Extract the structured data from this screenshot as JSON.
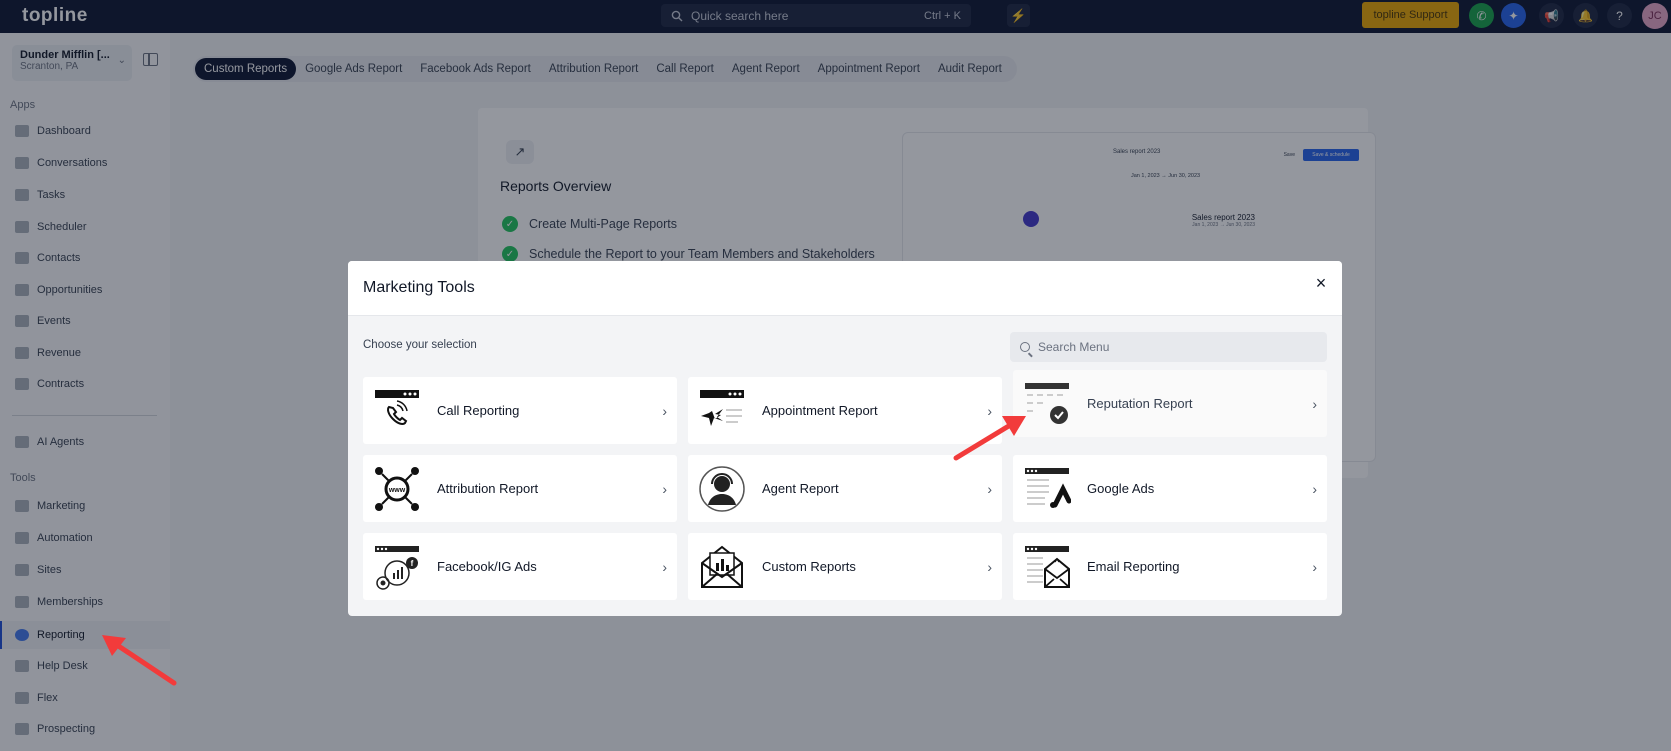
{
  "topbar": {
    "logo": "topline",
    "search_placeholder": "Quick search here",
    "search_shortcut": "Ctrl + K",
    "support_label": "topline Support",
    "avatar_initials": "JC"
  },
  "sidebar": {
    "account_name": "Dunder Mifflin [...",
    "account_location": "Scranton, PA",
    "apps_label": "Apps",
    "tools_label": "Tools",
    "apps": [
      {
        "label": "Dashboard"
      },
      {
        "label": "Conversations"
      },
      {
        "label": "Tasks"
      },
      {
        "label": "Scheduler"
      },
      {
        "label": "Contacts"
      },
      {
        "label": "Opportunities"
      },
      {
        "label": "Events"
      },
      {
        "label": "Revenue"
      },
      {
        "label": "Contracts"
      }
    ],
    "ai_agents": "AI Agents",
    "tools": [
      {
        "label": "Marketing"
      },
      {
        "label": "Automation"
      },
      {
        "label": "Sites"
      },
      {
        "label": "Memberships"
      },
      {
        "label": "Reporting"
      },
      {
        "label": "Help Desk"
      },
      {
        "label": "Flex"
      },
      {
        "label": "Prospecting"
      }
    ]
  },
  "tabs": [
    {
      "label": "Custom Reports",
      "active": true
    },
    {
      "label": "Google Ads Report"
    },
    {
      "label": "Facebook Ads Report"
    },
    {
      "label": "Attribution Report"
    },
    {
      "label": "Call Report"
    },
    {
      "label": "Agent Report"
    },
    {
      "label": "Appointment Report"
    },
    {
      "label": "Audit Report"
    }
  ],
  "overview": {
    "title": "Reports Overview",
    "items": [
      "Create Multi-Page Reports",
      "Schedule the Report to your Team Members and Stakeholders"
    ],
    "preview_title": "Sales report 2023",
    "preview_report_title": "Sales report 2023",
    "preview_date": "Jan 1, 2023 → Jun 30, 2023",
    "preview_save": "Save",
    "preview_button": "Save & schedule"
  },
  "modal": {
    "title": "Marketing Tools",
    "choose_label": "Choose your selection",
    "search_placeholder": "Search Menu",
    "tiles": [
      {
        "label": "Call Reporting",
        "icon": "phone-report-icon"
      },
      {
        "label": "Appointment Report",
        "icon": "calendar-report-icon"
      },
      {
        "label": "Reputation Report",
        "icon": "reputation-check-icon"
      },
      {
        "label": "Attribution Report",
        "icon": "www-network-icon"
      },
      {
        "label": "Agent Report",
        "icon": "agent-headset-icon"
      },
      {
        "label": "Google Ads",
        "icon": "google-ads-icon"
      },
      {
        "label": "Facebook/IG Ads",
        "icon": "facebook-ig-icon"
      },
      {
        "label": "Custom Reports",
        "icon": "envelope-chart-icon"
      },
      {
        "label": "Email Reporting",
        "icon": "email-report-icon"
      }
    ]
  },
  "colors": {
    "navy": "#0b1430",
    "accent_yellow": "#e9a700",
    "annotation_red": "#f23b3b",
    "check_green": "#22c55e"
  }
}
